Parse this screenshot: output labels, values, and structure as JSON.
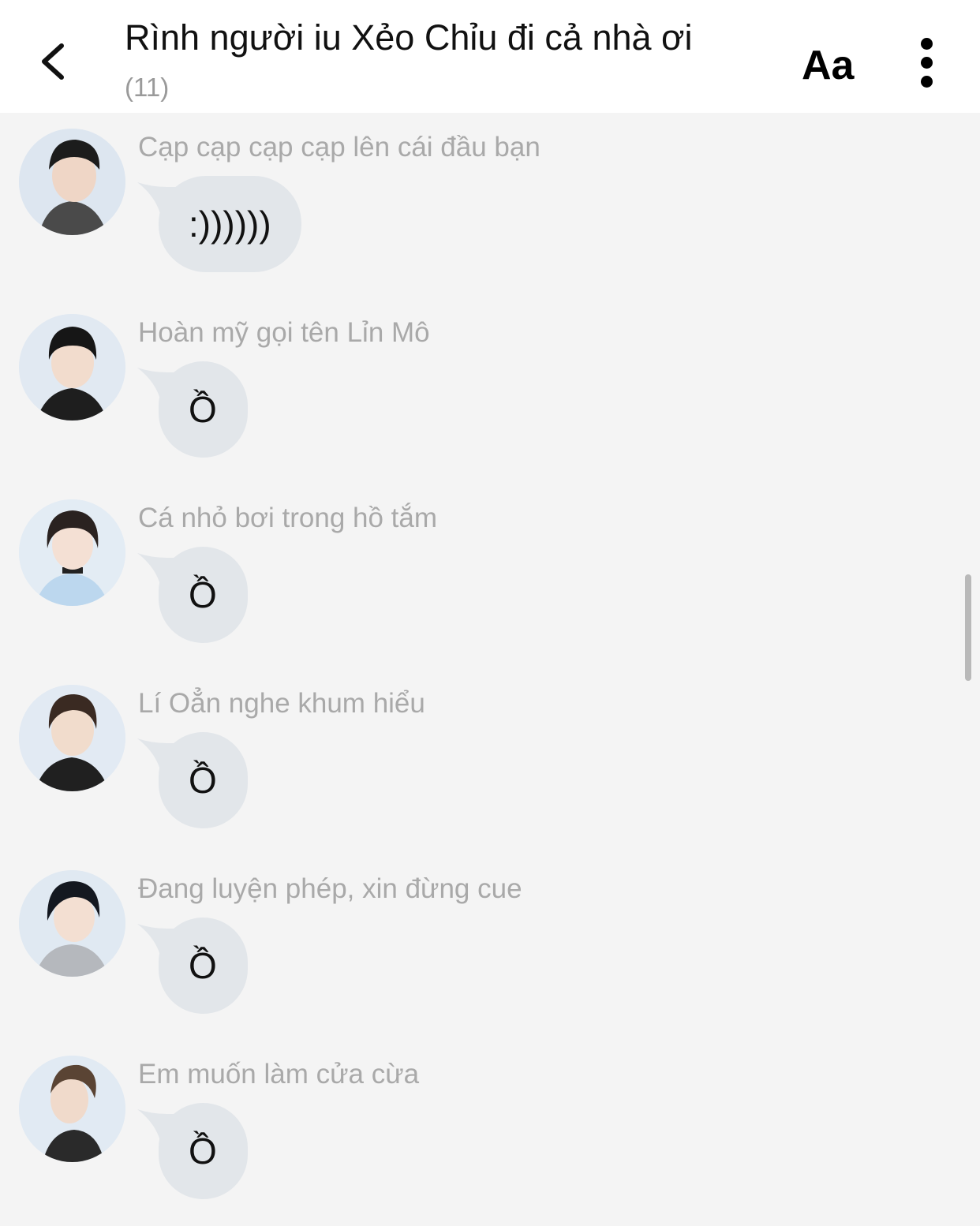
{
  "header": {
    "title": "Rình người iu Xẻo Chỉu đi cả nhà ơi",
    "member_count": "(11)",
    "font_button": "Aa",
    "back_icon": "chevron-left-icon",
    "more_icon": "vertical-dots-icon"
  },
  "messages": [
    {
      "sender": "Cạp cạp cạp cạp lên cái đầu bạn",
      "text": ":))))))",
      "avatar": "avatar-photo"
    },
    {
      "sender": "Hoàn mỹ gọi tên Lỉn Mô",
      "text": "Ồ",
      "avatar": "avatar-photo"
    },
    {
      "sender": "Cá nhỏ bơi trong hồ tắm",
      "text": "Ồ",
      "avatar": "avatar-photo"
    },
    {
      "sender": "Lí Oẳn nghe khum hiểu",
      "text": "Ồ",
      "avatar": "avatar-photo"
    },
    {
      "sender": "Đang luyện phép, xin đừng cue",
      "text": "Ồ",
      "avatar": "avatar-photo"
    },
    {
      "sender": "Em muốn làm cửa cừa",
      "text": "Ồ",
      "avatar": "avatar-photo"
    }
  ],
  "colors": {
    "header_bg": "#ffffff",
    "chat_bg": "#f4f4f4",
    "bubble_bg": "#e2e6ea",
    "sender_text": "#a9a9a9"
  }
}
